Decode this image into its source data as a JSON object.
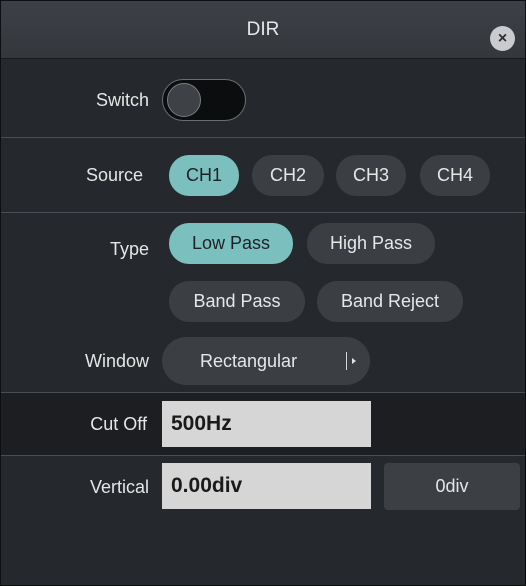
{
  "title": "DIR",
  "close_icon_label": "×",
  "switch": {
    "label": "Switch",
    "state": "off"
  },
  "source": {
    "label": "Source",
    "options": [
      "CH1",
      "CH2",
      "CH3",
      "CH4"
    ],
    "selected": "CH1"
  },
  "type": {
    "label": "Type",
    "options": [
      "Low Pass",
      "High Pass",
      "Band Pass",
      "Band Reject"
    ],
    "selected": "Low Pass"
  },
  "window": {
    "label": "Window",
    "value": "Rectangular"
  },
  "cutoff": {
    "label": "Cut Off",
    "value": "500Hz"
  },
  "vertical": {
    "label": "Vertical",
    "value": "0.00div",
    "reset_label": "0div"
  },
  "colors": {
    "accent": "#7bc0be",
    "panel": "#25282c",
    "button": "#3b3f44"
  }
}
